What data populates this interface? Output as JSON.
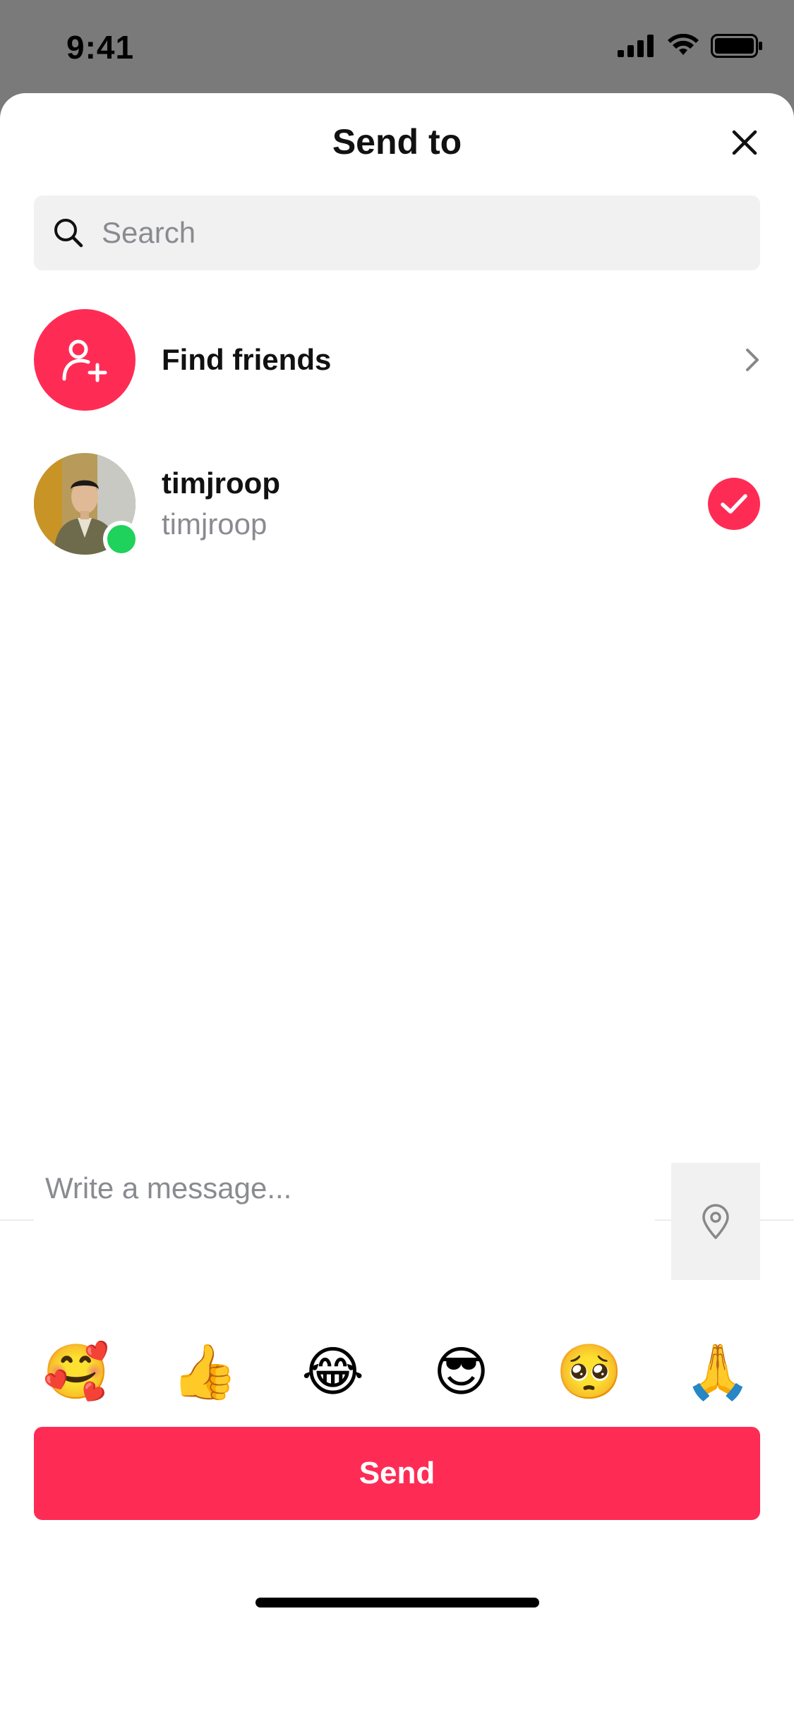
{
  "status_bar": {
    "time": "9:41"
  },
  "sheet": {
    "title": "Send to",
    "search": {
      "placeholder": "Search",
      "value": ""
    },
    "find_friends": {
      "label": "Find friends"
    },
    "contacts": [
      {
        "name": "timjroop",
        "handle": "timjroop",
        "selected": true,
        "online": true
      }
    ],
    "message": {
      "placeholder": "Write a message...",
      "value": ""
    },
    "emojis": [
      "🥰",
      "👍",
      "😂",
      "😎",
      "🥺",
      "🙏"
    ],
    "send_label": "Send"
  },
  "colors": {
    "accent": "#fe2c55",
    "online": "#1fd25c",
    "muted_text": "#8a8b91",
    "field_bg": "#f1f1f2"
  },
  "icons": {
    "close": "close-icon",
    "search": "search-icon",
    "find_friends": "add-user-icon",
    "chevron": "chevron-right-icon",
    "check": "checkmark-icon",
    "location": "location-pin-icon"
  }
}
